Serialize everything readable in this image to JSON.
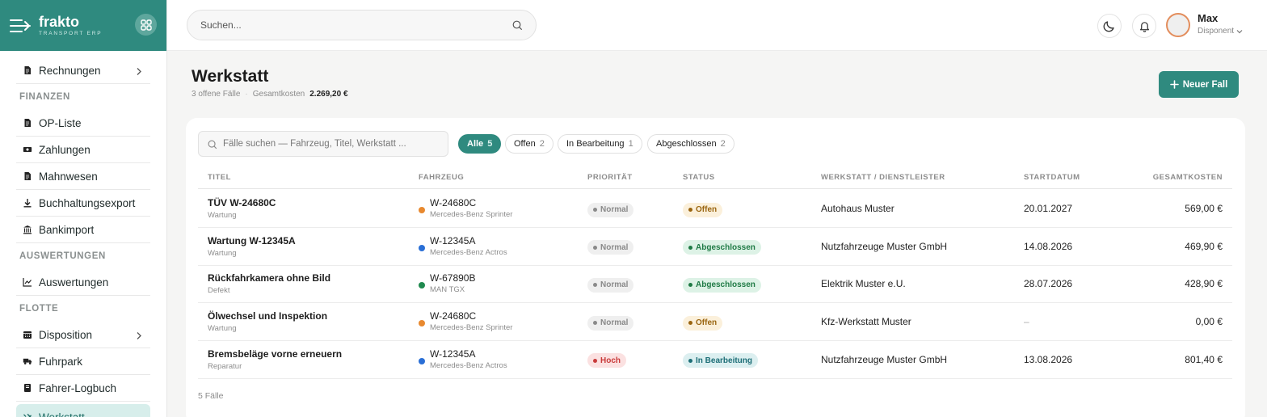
{
  "brand": {
    "name": "frakto",
    "tagline": "TRANSPORT ERP"
  },
  "sidebar": {
    "items": [
      {
        "type": "item",
        "label": "Rechnungen",
        "icon": "document-icon",
        "chevron": true
      },
      {
        "type": "section",
        "label": "FINANZEN"
      },
      {
        "type": "item",
        "label": "OP-Liste",
        "icon": "document-icon"
      },
      {
        "type": "item",
        "label": "Zahlungen",
        "icon": "cash-icon"
      },
      {
        "type": "item",
        "label": "Mahnwesen",
        "icon": "document-icon"
      },
      {
        "type": "item",
        "label": "Buchhaltungsexport",
        "icon": "download-icon"
      },
      {
        "type": "item",
        "label": "Bankimport",
        "icon": "bank-icon"
      },
      {
        "type": "section",
        "label": "AUSWERTUNGEN"
      },
      {
        "type": "item",
        "label": "Auswertungen",
        "icon": "chart-icon"
      },
      {
        "type": "section",
        "label": "FLOTTE"
      },
      {
        "type": "item",
        "label": "Disposition",
        "icon": "calendar-icon",
        "chevron": true
      },
      {
        "type": "item",
        "label": "Fuhrpark",
        "icon": "truck-icon"
      },
      {
        "type": "item",
        "label": "Fahrer-Logbuch",
        "icon": "book-icon"
      },
      {
        "type": "item",
        "label": "Werkstatt",
        "icon": "wrench-icon",
        "active": true
      }
    ]
  },
  "topbar": {
    "search_placeholder": "Suchen...",
    "user_name": "Max",
    "user_role": "Disponent"
  },
  "page": {
    "title": "Werkstatt",
    "open_cases": "3 offene Fälle",
    "separator": "·",
    "total_label": "Gesamtkosten",
    "total_value": "2.269,20 €",
    "new_button": "Neuer Fall"
  },
  "filters": {
    "search_placeholder": "Fälle suchen — Fahrzeug, Titel, Werkstatt ...",
    "chips": [
      {
        "label": "Alle",
        "count": "5",
        "active": true
      },
      {
        "label": "Offen",
        "count": "2"
      },
      {
        "label": "In Bearbeitung",
        "count": "1"
      },
      {
        "label": "Abgeschlossen",
        "count": "2"
      }
    ]
  },
  "table": {
    "headers": {
      "title": "TITEL",
      "vehicle": "FAHRZEUG",
      "priority": "PRIORITÄT",
      "status": "STATUS",
      "workshop": "WERKSTATT / DIENSTLEISTER",
      "start": "STARTDATUM",
      "cost": "GESAMTKOSTEN"
    },
    "rows": [
      {
        "title": "TÜV W-24680C",
        "type": "Wartung",
        "plate": "W-24680C",
        "model": "Mercedes-Benz Sprinter",
        "dot": "#e8892f",
        "priority": "Normal",
        "status": "Offen",
        "workshop": "Autohaus Muster",
        "start": "20.01.2027",
        "cost": "569,00 €"
      },
      {
        "title": "Wartung W-12345A",
        "type": "Wartung",
        "plate": "W-12345A",
        "model": "Mercedes-Benz Actros",
        "dot": "#2a6fd6",
        "priority": "Normal",
        "status": "Abgeschlossen",
        "workshop": "Nutzfahrzeuge Muster GmbH",
        "start": "14.08.2026",
        "cost": "469,90 €"
      },
      {
        "title": "Rückfahrkamera ohne Bild",
        "type": "Defekt",
        "plate": "W-67890B",
        "model": "MAN TGX",
        "dot": "#1f8a4f",
        "priority": "Normal",
        "status": "Abgeschlossen",
        "workshop": "Elektrik Muster e.U.",
        "start": "28.07.2026",
        "cost": "428,90 €"
      },
      {
        "title": "Ölwechsel und Inspektion",
        "type": "Wartung",
        "plate": "W-24680C",
        "model": "Mercedes-Benz Sprinter",
        "dot": "#e8892f",
        "priority": "Normal",
        "status": "Offen",
        "workshop": "Kfz-Werkstatt Muster",
        "start": "–",
        "cost": "0,00 €"
      },
      {
        "title": "Bremsbeläge vorne erneuern",
        "type": "Reparatur",
        "plate": "W-12345A",
        "model": "Mercedes-Benz Actros",
        "dot": "#2a6fd6",
        "priority": "Hoch",
        "status": "In Bearbeitung",
        "workshop": "Nutzfahrzeuge Muster GmbH",
        "start": "13.08.2026",
        "cost": "801,40 €"
      }
    ],
    "footer": "5 Fälle"
  },
  "colors": {
    "accent": "#2f8a7f",
    "priority": {
      "Normal": {
        "bg": "#efefef",
        "fg": "#8a8a8a"
      },
      "Hoch": {
        "bg": "#fbe1e1",
        "fg": "#c93b3b"
      }
    },
    "status": {
      "Offen": {
        "bg": "#fbf0db",
        "fg": "#9a6510",
        "dot": "#9a6510"
      },
      "Abgeschlossen": {
        "bg": "#ddf2e6",
        "fg": "#1f7a45",
        "dot": "#1f7a45"
      },
      "In Bearbeitung": {
        "bg": "#dceff0",
        "fg": "#1d6e77",
        "dot": "#1d6e77"
      }
    }
  }
}
